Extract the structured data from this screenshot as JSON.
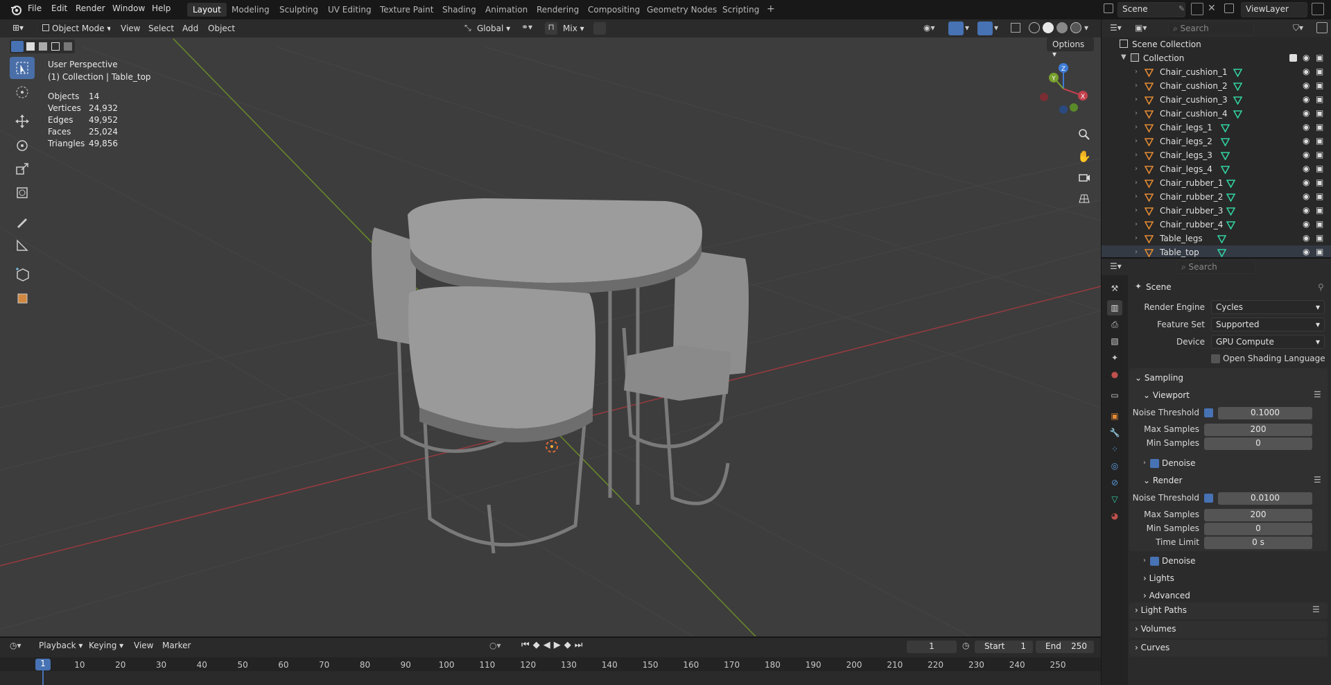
{
  "menubar": {
    "items": [
      "File",
      "Edit",
      "Render",
      "Window",
      "Help"
    ],
    "workspaces": [
      "Layout",
      "Modeling",
      "Sculpting",
      "UV Editing",
      "Texture Paint",
      "Shading",
      "Animation",
      "Rendering",
      "Compositing",
      "Geometry Nodes",
      "Scripting"
    ],
    "active_workspace": "Layout",
    "add_tab": "+",
    "scene_name": "Scene",
    "view_layer": "ViewLayer"
  },
  "viewport_header": {
    "mode": "Object Mode",
    "menus": [
      "View",
      "Select",
      "Add",
      "Object"
    ],
    "orientation": "Global",
    "snap": "Mix",
    "options": "Options"
  },
  "viewport": {
    "perspective": "User Perspective",
    "collection_line": "(1) Collection | Table_top",
    "stats": [
      {
        "label": "Objects",
        "value": "14"
      },
      {
        "label": "Vertices",
        "value": "24,932"
      },
      {
        "label": "Edges",
        "value": "49,952"
      },
      {
        "label": "Faces",
        "value": "25,024"
      },
      {
        "label": "Triangles",
        "value": "49,856"
      }
    ],
    "gizmo": {
      "x": "X",
      "y": "Y",
      "z": "Z"
    }
  },
  "outliner": {
    "search_placeholder": "Search",
    "scene_collection": "Scene Collection",
    "collection": "Collection",
    "objects": [
      "Chair_cushion_1",
      "Chair_cushion_2",
      "Chair_cushion_3",
      "Chair_cushion_4",
      "Chair_legs_1",
      "Chair_legs_2",
      "Chair_legs_3",
      "Chair_legs_4",
      "Chair_rubber_1",
      "Chair_rubber_2",
      "Chair_rubber_3",
      "Chair_rubber_4",
      "Table_legs",
      "Table_top"
    ],
    "selected": "Table_top"
  },
  "properties": {
    "search_placeholder": "Search",
    "context": "Scene",
    "render_engine_label": "Render Engine",
    "render_engine": "Cycles",
    "feature_set_label": "Feature Set",
    "feature_set": "Supported",
    "device_label": "Device",
    "device": "GPU Compute",
    "osl_label": "Open Shading Language",
    "sampling": "Sampling",
    "viewport_section": "Viewport",
    "render_section": "Render",
    "noise_threshold_label": "Noise Threshold",
    "max_samples_label": "Max Samples",
    "min_samples_label": "Min Samples",
    "time_limit_label": "Time Limit",
    "denoise_label": "Denoise",
    "viewport_noise": "0.1000",
    "viewport_max": "200",
    "viewport_min": "0",
    "render_noise": "0.0100",
    "render_max": "200",
    "render_min": "0",
    "render_time_limit": "0 s",
    "lights": "Lights",
    "advanced": "Advanced",
    "light_paths": "Light Paths",
    "volumes": "Volumes",
    "curves": "Curves"
  },
  "timeline": {
    "menus": [
      "Playback",
      "Keying",
      "View",
      "Marker"
    ],
    "current_frame": "1",
    "start_label": "Start",
    "start": "1",
    "end_label": "End",
    "end": "250",
    "frames": [
      "1",
      "10",
      "20",
      "30",
      "40",
      "50",
      "60",
      "70",
      "80",
      "90",
      "100",
      "110",
      "120",
      "130",
      "140",
      "150",
      "160",
      "170",
      "180",
      "190",
      "200",
      "210",
      "220",
      "230",
      "240",
      "250"
    ]
  },
  "colors": {
    "accent": "#4772b3",
    "x_axis": "#c2414d",
    "y_axis": "#78a02d",
    "z_axis": "#3d7bd6",
    "object_icon": "#e38a33",
    "mesh_icon": "#32d0a0"
  }
}
